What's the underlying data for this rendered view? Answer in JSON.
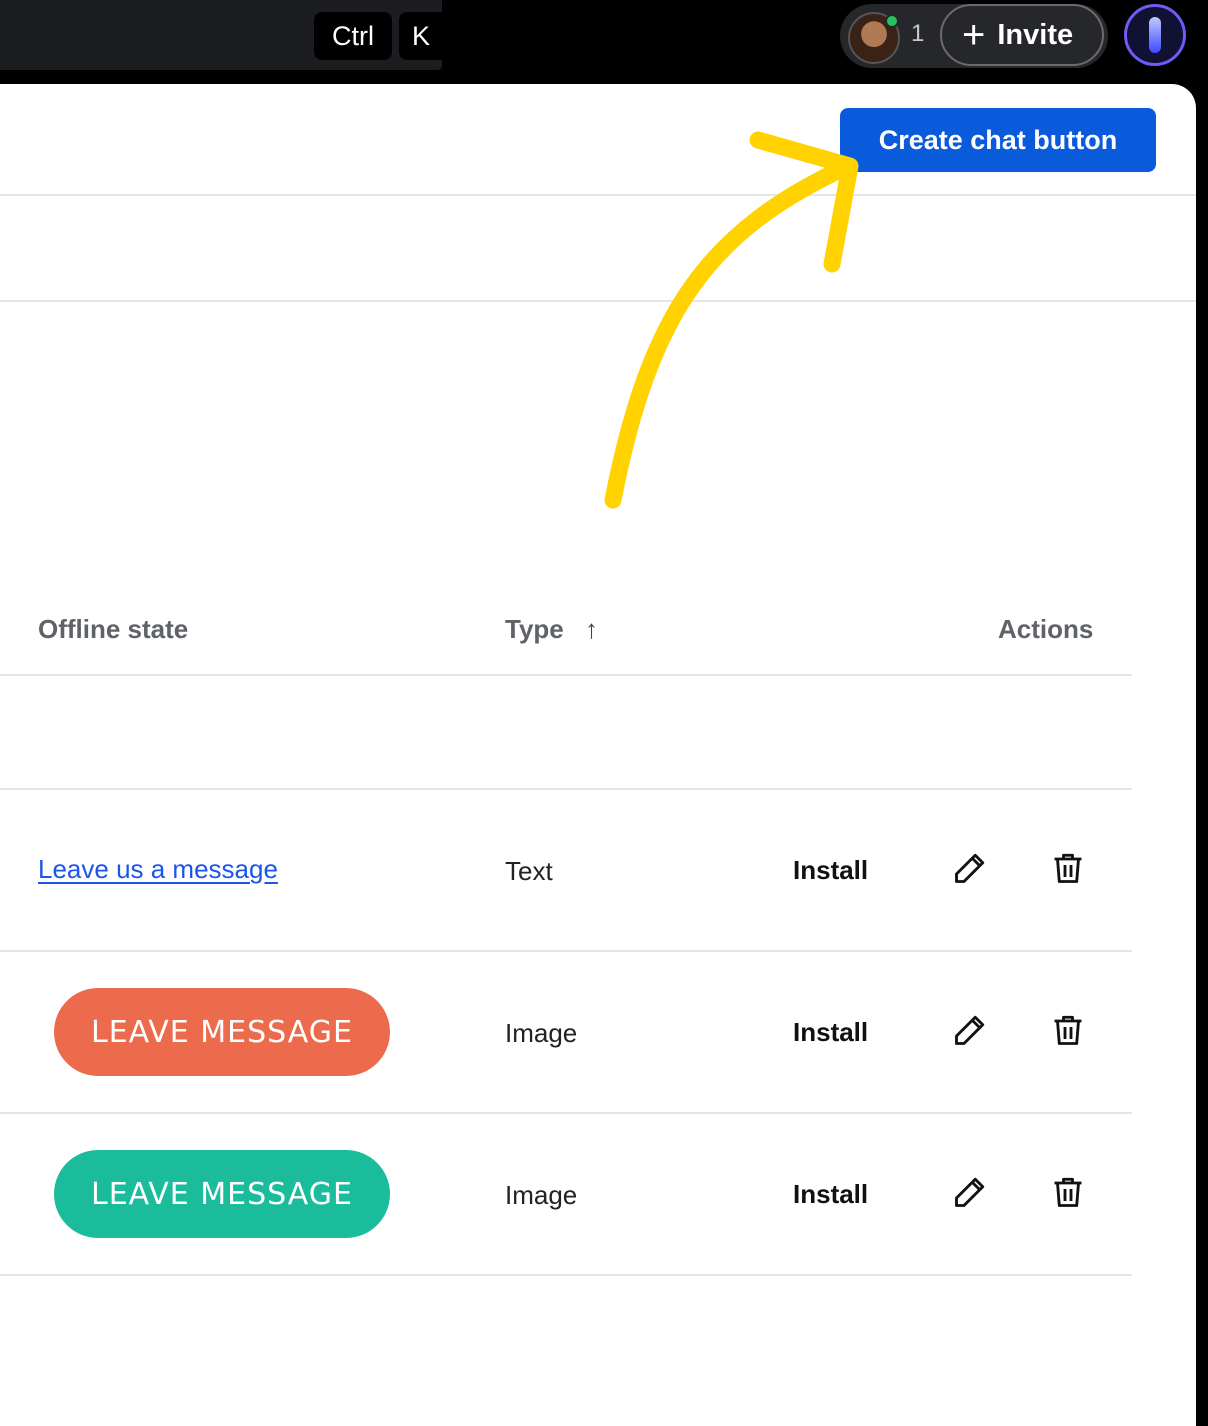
{
  "topbar": {
    "kbd_ctrl": "Ctrl",
    "kbd_k": "K",
    "presence_count": "1",
    "invite_label": "Invite",
    "plus": "+"
  },
  "header": {
    "create_button": "Create chat button"
  },
  "table": {
    "columns": {
      "offline_state": "Offline state",
      "type": "Type",
      "sort_arrow": "↑",
      "actions": "Actions"
    },
    "rows": [
      {
        "offline": "Leave us a message",
        "type": "Text",
        "action": "Install"
      },
      {
        "offline": "LEAVE MESSAGE",
        "type": "Image",
        "action": "Install",
        "pill_color": "#ec6b4c"
      },
      {
        "offline": "LEAVE MESSAGE",
        "type": "Image",
        "action": "Install",
        "pill_color": "#1bbc9b"
      }
    ]
  },
  "colors": {
    "primary": "#0a5bdc",
    "annotation": "#ffd200",
    "link": "#1a56e8"
  },
  "icons": [
    "pencil-icon",
    "trash-icon",
    "plus-icon",
    "ai-assistant-icon"
  ]
}
